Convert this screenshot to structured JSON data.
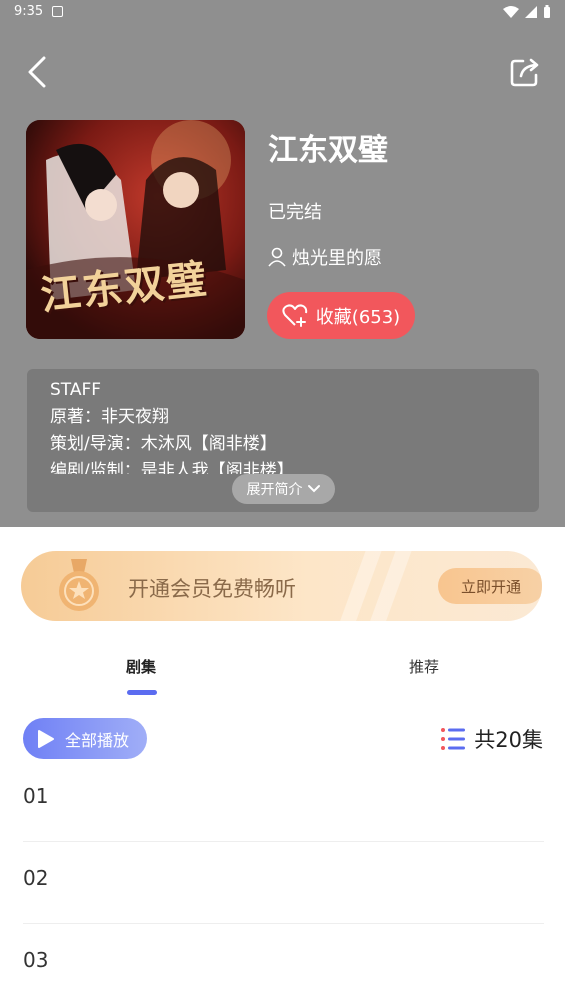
{
  "status_bar": {
    "time": "9:35"
  },
  "header": {
    "title": "江东双璧",
    "status": "已完结",
    "author": "烛光里的愿",
    "favorite_label": "收藏(653)",
    "cover_text": "江东双璧"
  },
  "staff": {
    "lines": [
      "STAFF",
      "原著：非天夜翔",
      "策划/导演：木沐风【阁非楼】",
      "编剧/监制：是非人我【阁非楼】"
    ],
    "expand_label": "展开简介"
  },
  "vip": {
    "text": "开通会员免费畅听",
    "button": "立即开通"
  },
  "tabs": [
    {
      "label": "剧集",
      "active": true
    },
    {
      "label": "推荐",
      "active": false
    }
  ],
  "play_all_label": "全部播放",
  "episode_count": "共20集",
  "episodes": [
    "01",
    "02",
    "03"
  ],
  "colors": {
    "accent": "#5b6cf0",
    "favorite": "#f2575c",
    "header_bg": "#8f8f8f"
  }
}
